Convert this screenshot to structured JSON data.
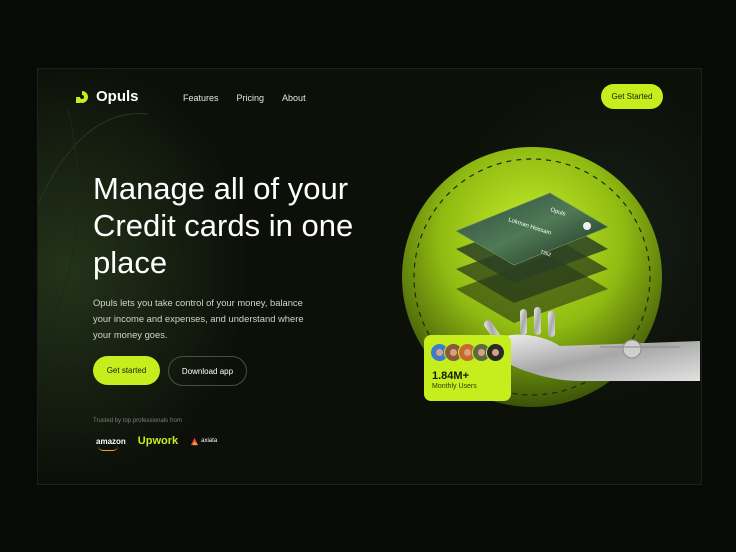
{
  "brand": {
    "name": "Opuls",
    "accent": "#c6ed1c",
    "logo_icon": "opuls-logo-icon"
  },
  "nav": {
    "items": [
      "Features",
      "Pricing",
      "About"
    ]
  },
  "header": {
    "cta_label": "Get Started"
  },
  "hero": {
    "title": "Manage all of your Credit cards in one place",
    "description": "Opuls lets you take control of your money, balance your income and expenses, and understand where your money goes.",
    "primary_button": "Get started",
    "secondary_button": "Download app"
  },
  "trusted": {
    "label": "Trusted by top professionals from",
    "brands": [
      "amazon",
      "Upwork",
      "axiata"
    ]
  },
  "card": {
    "holder": "Lokman Hossain",
    "number_suffix": "7352",
    "brand": "Opuls"
  },
  "stats": {
    "value": "1.84M+",
    "label": "Monthly Users",
    "avatar_colors": [
      "#3a7bd5",
      "#8a5a3c",
      "#c46a2f",
      "#5b6b4a",
      "#2a2a2a"
    ]
  }
}
